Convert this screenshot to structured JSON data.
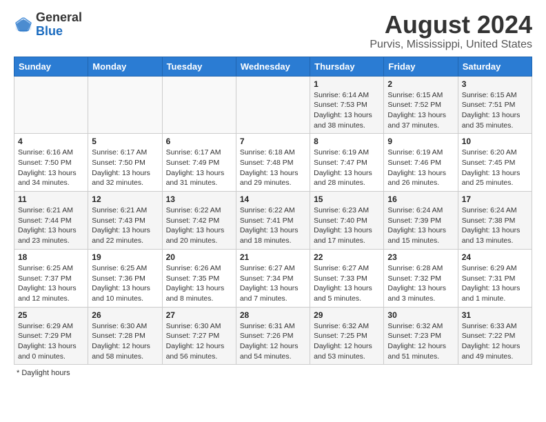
{
  "header": {
    "logo_general": "General",
    "logo_blue": "Blue",
    "title": "August 2024",
    "subtitle": "Purvis, Mississippi, United States"
  },
  "weekdays": [
    "Sunday",
    "Monday",
    "Tuesday",
    "Wednesday",
    "Thursday",
    "Friday",
    "Saturday"
  ],
  "footer": {
    "label": "Daylight hours"
  },
  "weeks": [
    [
      {
        "day": "",
        "info": ""
      },
      {
        "day": "",
        "info": ""
      },
      {
        "day": "",
        "info": ""
      },
      {
        "day": "",
        "info": ""
      },
      {
        "day": "1",
        "info": "Sunrise: 6:14 AM\nSunset: 7:53 PM\nDaylight: 13 hours and 38 minutes."
      },
      {
        "day": "2",
        "info": "Sunrise: 6:15 AM\nSunset: 7:52 PM\nDaylight: 13 hours and 37 minutes."
      },
      {
        "day": "3",
        "info": "Sunrise: 6:15 AM\nSunset: 7:51 PM\nDaylight: 13 hours and 35 minutes."
      }
    ],
    [
      {
        "day": "4",
        "info": "Sunrise: 6:16 AM\nSunset: 7:50 PM\nDaylight: 13 hours and 34 minutes."
      },
      {
        "day": "5",
        "info": "Sunrise: 6:17 AM\nSunset: 7:50 PM\nDaylight: 13 hours and 32 minutes."
      },
      {
        "day": "6",
        "info": "Sunrise: 6:17 AM\nSunset: 7:49 PM\nDaylight: 13 hours and 31 minutes."
      },
      {
        "day": "7",
        "info": "Sunrise: 6:18 AM\nSunset: 7:48 PM\nDaylight: 13 hours and 29 minutes."
      },
      {
        "day": "8",
        "info": "Sunrise: 6:19 AM\nSunset: 7:47 PM\nDaylight: 13 hours and 28 minutes."
      },
      {
        "day": "9",
        "info": "Sunrise: 6:19 AM\nSunset: 7:46 PM\nDaylight: 13 hours and 26 minutes."
      },
      {
        "day": "10",
        "info": "Sunrise: 6:20 AM\nSunset: 7:45 PM\nDaylight: 13 hours and 25 minutes."
      }
    ],
    [
      {
        "day": "11",
        "info": "Sunrise: 6:21 AM\nSunset: 7:44 PM\nDaylight: 13 hours and 23 minutes."
      },
      {
        "day": "12",
        "info": "Sunrise: 6:21 AM\nSunset: 7:43 PM\nDaylight: 13 hours and 22 minutes."
      },
      {
        "day": "13",
        "info": "Sunrise: 6:22 AM\nSunset: 7:42 PM\nDaylight: 13 hours and 20 minutes."
      },
      {
        "day": "14",
        "info": "Sunrise: 6:22 AM\nSunset: 7:41 PM\nDaylight: 13 hours and 18 minutes."
      },
      {
        "day": "15",
        "info": "Sunrise: 6:23 AM\nSunset: 7:40 PM\nDaylight: 13 hours and 17 minutes."
      },
      {
        "day": "16",
        "info": "Sunrise: 6:24 AM\nSunset: 7:39 PM\nDaylight: 13 hours and 15 minutes."
      },
      {
        "day": "17",
        "info": "Sunrise: 6:24 AM\nSunset: 7:38 PM\nDaylight: 13 hours and 13 minutes."
      }
    ],
    [
      {
        "day": "18",
        "info": "Sunrise: 6:25 AM\nSunset: 7:37 PM\nDaylight: 13 hours and 12 minutes."
      },
      {
        "day": "19",
        "info": "Sunrise: 6:25 AM\nSunset: 7:36 PM\nDaylight: 13 hours and 10 minutes."
      },
      {
        "day": "20",
        "info": "Sunrise: 6:26 AM\nSunset: 7:35 PM\nDaylight: 13 hours and 8 minutes."
      },
      {
        "day": "21",
        "info": "Sunrise: 6:27 AM\nSunset: 7:34 PM\nDaylight: 13 hours and 7 minutes."
      },
      {
        "day": "22",
        "info": "Sunrise: 6:27 AM\nSunset: 7:33 PM\nDaylight: 13 hours and 5 minutes."
      },
      {
        "day": "23",
        "info": "Sunrise: 6:28 AM\nSunset: 7:32 PM\nDaylight: 13 hours and 3 minutes."
      },
      {
        "day": "24",
        "info": "Sunrise: 6:29 AM\nSunset: 7:31 PM\nDaylight: 13 hours and 1 minute."
      }
    ],
    [
      {
        "day": "25",
        "info": "Sunrise: 6:29 AM\nSunset: 7:29 PM\nDaylight: 13 hours and 0 minutes."
      },
      {
        "day": "26",
        "info": "Sunrise: 6:30 AM\nSunset: 7:28 PM\nDaylight: 12 hours and 58 minutes."
      },
      {
        "day": "27",
        "info": "Sunrise: 6:30 AM\nSunset: 7:27 PM\nDaylight: 12 hours and 56 minutes."
      },
      {
        "day": "28",
        "info": "Sunrise: 6:31 AM\nSunset: 7:26 PM\nDaylight: 12 hours and 54 minutes."
      },
      {
        "day": "29",
        "info": "Sunrise: 6:32 AM\nSunset: 7:25 PM\nDaylight: 12 hours and 53 minutes."
      },
      {
        "day": "30",
        "info": "Sunrise: 6:32 AM\nSunset: 7:23 PM\nDaylight: 12 hours and 51 minutes."
      },
      {
        "day": "31",
        "info": "Sunrise: 6:33 AM\nSunset: 7:22 PM\nDaylight: 12 hours and 49 minutes."
      }
    ]
  ]
}
